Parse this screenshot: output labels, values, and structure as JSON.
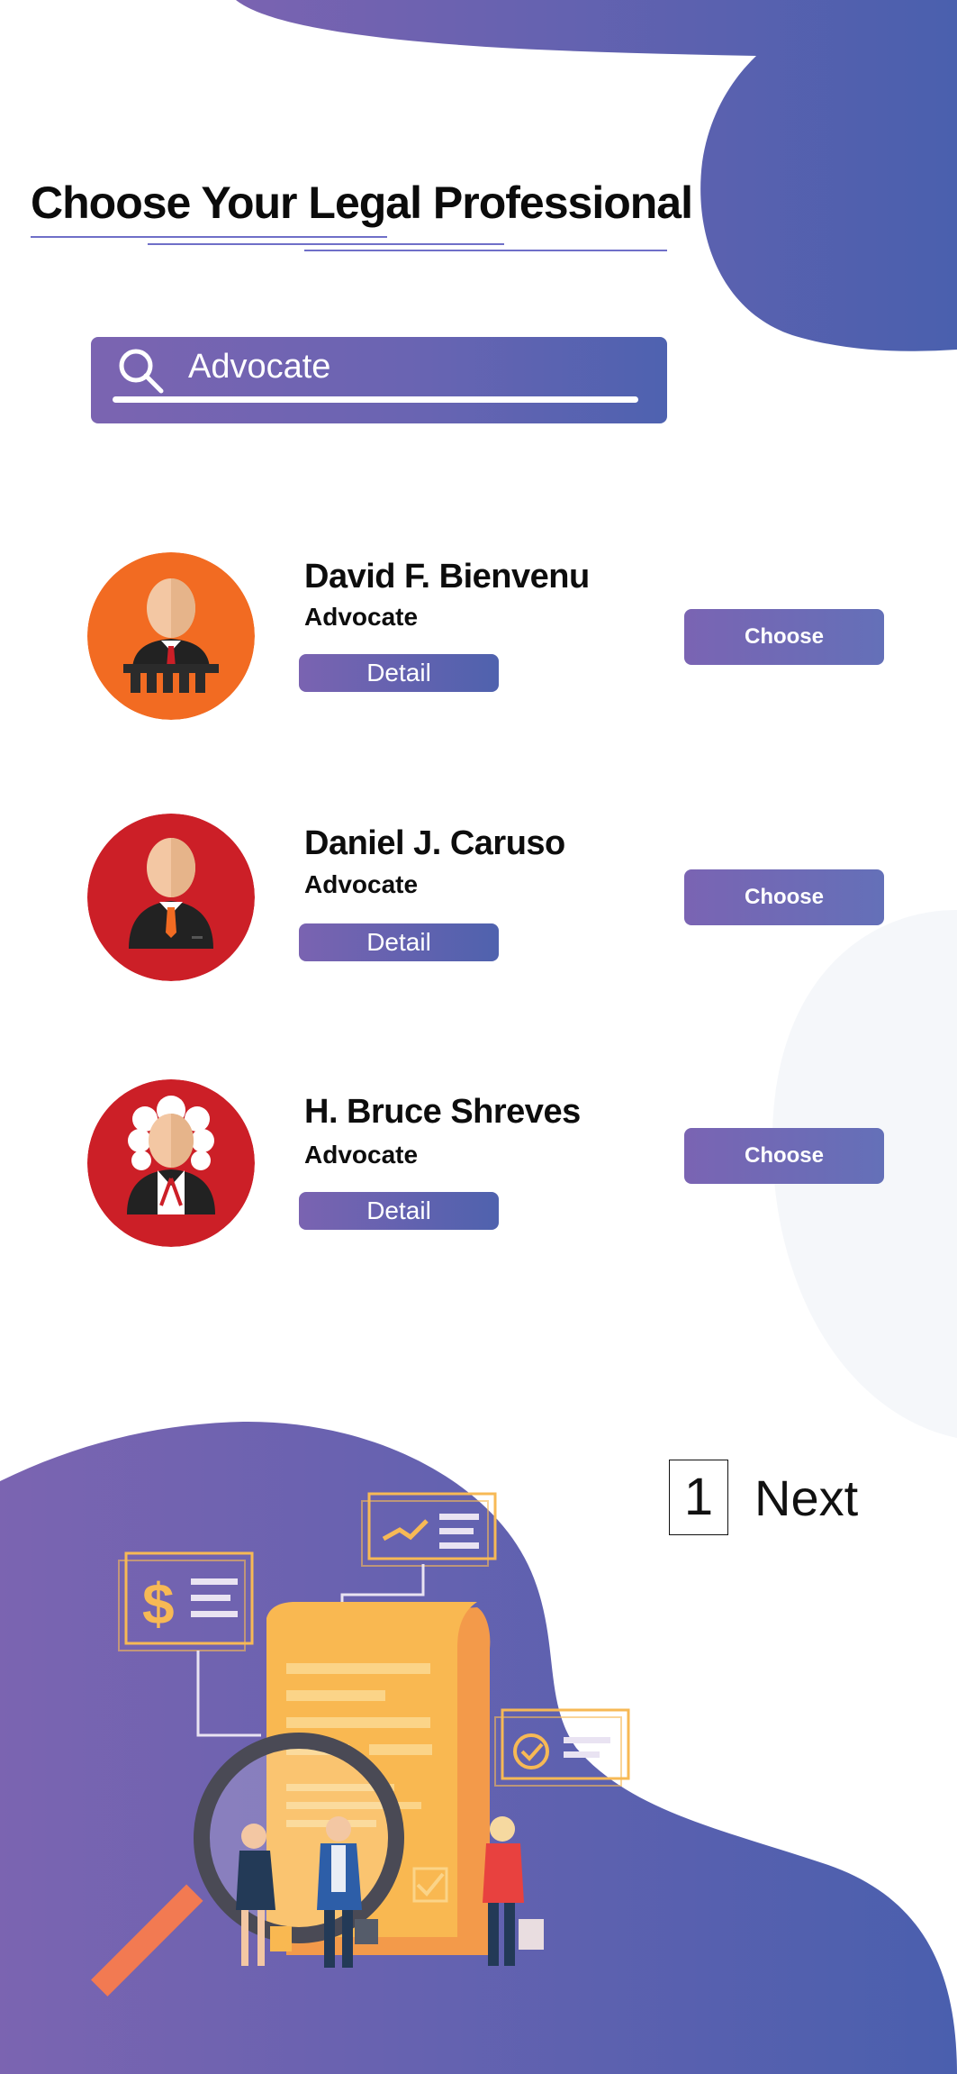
{
  "header": {
    "title": "Choose Your Legal Professional"
  },
  "search": {
    "query": "Advocate"
  },
  "professionals": [
    {
      "name": "David F. Bienvenu",
      "role": "Advocate",
      "detail_label": "Detail",
      "choose_label": "Choose",
      "avatar_bg": "#f26b22"
    },
    {
      "name": "Daniel J. Caruso",
      "role": "Advocate",
      "detail_label": "Detail",
      "choose_label": "Choose",
      "avatar_bg": "#cc1f27"
    },
    {
      "name": "H. Bruce Shreves",
      "role": "Advocate",
      "detail_label": "Detail",
      "choose_label": "Choose",
      "avatar_bg": "#cc1f27"
    }
  ],
  "pagination": {
    "current_page": "1",
    "next_label": "Next"
  },
  "colors": {
    "accent_start": "#7b64b1",
    "accent_end": "#4a5fae",
    "orange": "#f26b22",
    "red": "#cc1f27",
    "gold": "#f7b955"
  }
}
